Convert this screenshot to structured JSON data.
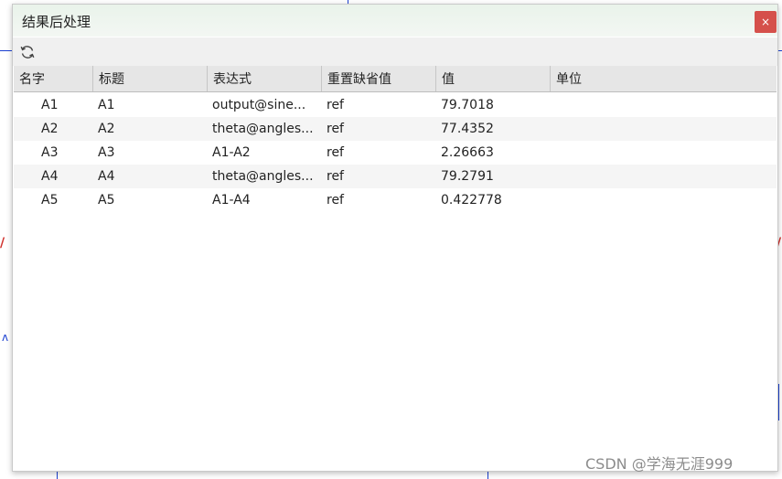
{
  "dialog": {
    "title": "结果后处理",
    "close_label": "×"
  },
  "table": {
    "columns": [
      "名字",
      "标题",
      "表达式",
      "重置缺省值",
      "值",
      "单位"
    ],
    "rows": [
      {
        "name": "A1",
        "title": "A1",
        "expression": "output@sine...",
        "reset": "ref",
        "value": "79.7018",
        "unit": ""
      },
      {
        "name": "A2",
        "title": "A2",
        "expression": "theta@angles...",
        "reset": "ref",
        "value": "77.4352",
        "unit": ""
      },
      {
        "name": "A3",
        "title": "A3",
        "expression": "A1-A2",
        "reset": "ref",
        "value": "2.26663",
        "unit": ""
      },
      {
        "name": "A4",
        "title": "A4",
        "expression": "theta@angles...",
        "reset": "ref",
        "value": "79.2791",
        "unit": ""
      },
      {
        "name": "A5",
        "title": "A5",
        "expression": "A1-A4",
        "reset": "ref",
        "value": "0.422778",
        "unit": ""
      }
    ]
  },
  "watermark": "CSDN @学海无涯999",
  "colors": {
    "close_button": "#d5504b",
    "header_bg": "#e6e6e6",
    "alt_row": "#f5f5f5"
  }
}
